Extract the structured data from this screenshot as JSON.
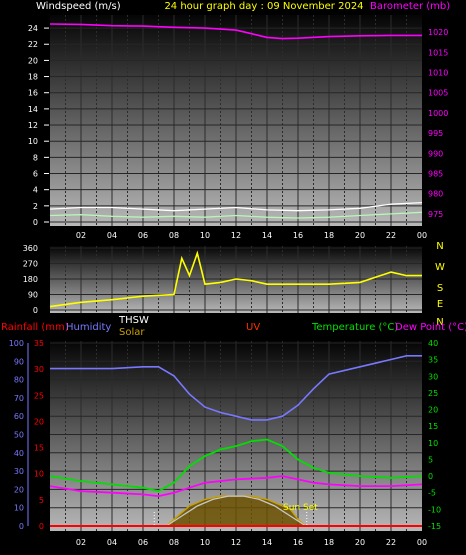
{
  "title": "24 hour graph day : 09 November 2024",
  "colors": {
    "background": "#000000",
    "axis_text": "#ffffff",
    "barometer": "#ff00ff",
    "wind_dir": "#ffff00",
    "wind_gust": "#ffffff",
    "wind_avg": "#b6f7b6",
    "rainfall": "#ff0000",
    "humidity": "#7878ff",
    "thsw": "#ffffff",
    "solar": "#c8a000",
    "uv": "#ff3000",
    "temperature": "#00e000",
    "dew_point": "#ff00ff",
    "solar_theory": "#c8c8c8"
  },
  "x_ticks": [
    "02",
    "04",
    "06",
    "08",
    "10",
    "12",
    "14",
    "16",
    "18",
    "20",
    "22",
    "00"
  ],
  "chart_data": [
    {
      "type": "line",
      "panel": "wind_baro",
      "title": "24 hour graph day : 09 November 2024",
      "ylabel_left": "Windspeed (m/s)",
      "ylabel_right": "Barometer (mb)",
      "left_ticks": [
        "24",
        "22",
        "20",
        "18",
        "16",
        "14",
        "12",
        "10",
        "8",
        "6",
        "4",
        "2",
        "0"
      ],
      "right_ticks": [
        "1020",
        "1015",
        "1010",
        "1005",
        "1000",
        "995",
        "990",
        "985",
        "980",
        "975"
      ],
      "ylim_left": [
        0,
        25
      ],
      "ylim_right": [
        973,
        1023
      ],
      "grid": true,
      "series": [
        {
          "name": "Barometer",
          "axis": "right",
          "x": [
            0,
            2,
            4,
            6,
            8,
            10,
            12,
            13,
            14,
            15,
            16,
            18,
            20,
            22,
            24
          ],
          "values": [
            1022,
            1021.9,
            1021.6,
            1021.5,
            1021.2,
            1021,
            1020.5,
            1019.6,
            1018.7,
            1018.4,
            1018.5,
            1018.9,
            1019.1,
            1019.2,
            1019.2
          ]
        },
        {
          "name": "Wind gust",
          "axis": "left",
          "x": [
            0,
            2,
            4,
            6,
            8,
            10,
            12,
            14,
            16,
            18,
            20,
            22,
            24
          ],
          "values": [
            1.6,
            1.8,
            1.8,
            1.6,
            1.4,
            1.6,
            1.8,
            1.5,
            1.4,
            1.5,
            1.7,
            2.2,
            2.4
          ]
        },
        {
          "name": "Wind average",
          "axis": "left",
          "x": [
            0,
            2,
            4,
            6,
            8,
            10,
            12,
            14,
            16,
            18,
            20,
            22,
            24
          ],
          "values": [
            0.8,
            0.9,
            0.7,
            0.6,
            0.7,
            0.6,
            0.8,
            0.6,
            0.5,
            0.6,
            0.8,
            1.0,
            1.2
          ]
        }
      ]
    },
    {
      "type": "line",
      "panel": "wind_direction",
      "left_ticks": [
        "360",
        "270",
        "180",
        "90",
        "0"
      ],
      "right_ticks": [
        "N",
        "W",
        "S",
        "E",
        "N"
      ],
      "ylim": [
        0,
        360
      ],
      "series": [
        {
          "name": "Wind direction",
          "x": [
            0,
            2,
            4,
            6,
            8,
            8.5,
            9,
            9.5,
            10,
            11,
            12,
            13,
            14,
            16,
            18,
            20,
            22,
            23,
            24
          ],
          "values": [
            20,
            45,
            60,
            80,
            90,
            300,
            200,
            330,
            150,
            160,
            180,
            170,
            150,
            150,
            150,
            160,
            220,
            200,
            200
          ]
        }
      ]
    },
    {
      "type": "line",
      "panel": "weather",
      "legend": [
        "Rainfall (mm)",
        "Humidity",
        "THSW",
        "Solar",
        "UV",
        "Temperature (°C)",
        "Dew Point (°C)"
      ],
      "left_ticks_humidity": [
        "100",
        "90",
        "80",
        "70",
        "60",
        "50",
        "40",
        "30",
        "20",
        "10",
        "0"
      ],
      "left_ticks_rain": [
        "35",
        "30",
        "25",
        "20",
        "15",
        "10",
        "5",
        "0"
      ],
      "right_ticks_temp": [
        "40",
        "35",
        "30",
        "25",
        "20",
        "15",
        "10",
        "5",
        "0",
        "-5",
        "-10",
        "-15"
      ],
      "ylim_humidity": [
        0,
        100
      ],
      "ylim_rain": [
        0,
        35
      ],
      "ylim_temp": [
        -15,
        40
      ],
      "annotation": "Sun Set",
      "series": [
        {
          "name": "Humidity",
          "axis": "humidity",
          "x": [
            0,
            2,
            4,
            6,
            7,
            8,
            9,
            10,
            11,
            12,
            13,
            14,
            15,
            16,
            17,
            18,
            20,
            22,
            23,
            24
          ],
          "values": [
            86,
            86,
            86,
            87,
            87,
            82,
            72,
            65,
            62,
            60,
            58,
            58,
            60,
            66,
            75,
            83,
            87,
            91,
            93,
            93
          ]
        },
        {
          "name": "Temperature",
          "axis": "temp",
          "x": [
            0,
            2,
            4,
            6,
            7,
            8,
            9,
            10,
            11,
            12,
            13,
            14,
            15,
            16,
            17,
            18,
            20,
            22,
            24
          ],
          "values": [
            0,
            -1.5,
            -2.5,
            -3.5,
            -4.5,
            -2,
            3,
            6,
            8,
            9,
            10.5,
            11,
            9,
            5,
            2.5,
            1,
            0,
            -0.5,
            0
          ]
        },
        {
          "name": "Dew Point",
          "axis": "temp",
          "x": [
            0,
            2,
            4,
            6,
            7,
            8,
            9,
            10,
            12,
            14,
            15,
            16,
            17,
            18,
            20,
            22,
            24
          ],
          "values": [
            -3,
            -4.5,
            -5,
            -5.5,
            -6,
            -5,
            -3.5,
            -2,
            -1,
            -0.5,
            0,
            -1,
            -2,
            -2.5,
            -3,
            -3,
            -2.5
          ]
        },
        {
          "name": "Solar",
          "axis": "temp",
          "x": [
            7.5,
            8,
            9,
            10,
            11,
            12,
            13,
            14,
            15,
            15.5,
            16,
            16.5
          ],
          "values": [
            -15,
            -13,
            -9,
            -7,
            -6,
            -6,
            -6,
            -7,
            -9,
            -10,
            -13,
            -15
          ]
        },
        {
          "name": "Solar theoretical",
          "axis": "temp",
          "x": [
            7.5,
            8.5,
            9.5,
            10.5,
            11.5,
            12.5,
            13.5,
            14.5,
            15.5,
            16.5
          ],
          "values": [
            -15,
            -12,
            -9,
            -7,
            -6,
            -6,
            -7,
            -9,
            -12,
            -15
          ]
        },
        {
          "name": "Rainfall",
          "axis": "rain",
          "x": [
            0,
            24
          ],
          "values": [
            0,
            0
          ]
        }
      ]
    }
  ]
}
